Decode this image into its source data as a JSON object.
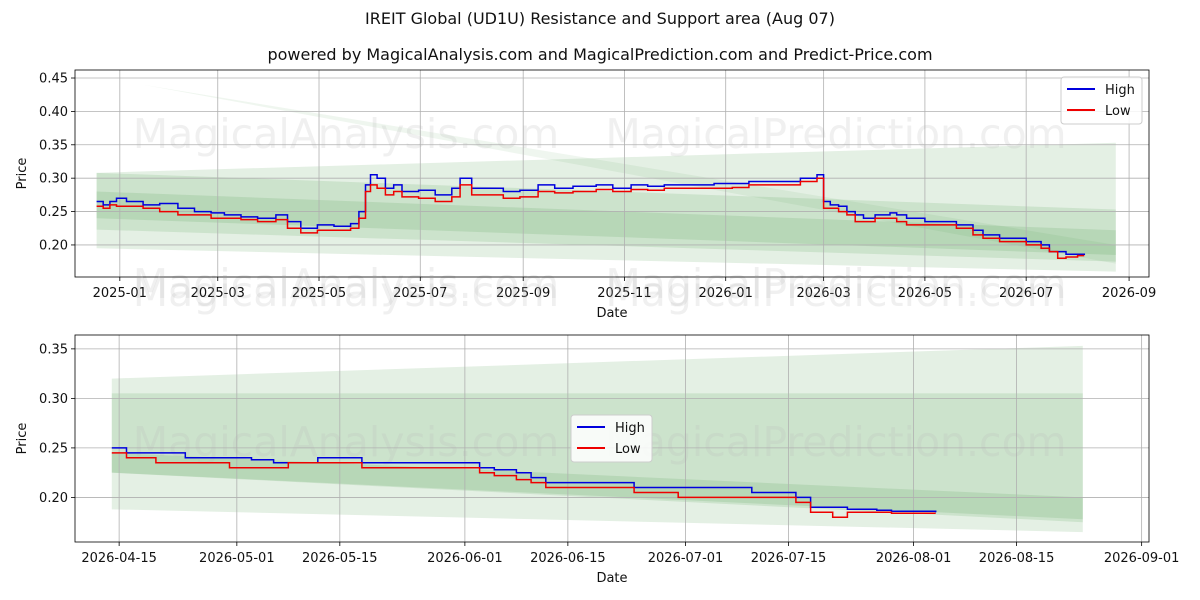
{
  "title": "IREIT Global (UD1U) Resistance and Support area (Aug 07)",
  "subtitle": "powered by MagicalAnalysis.com and MagicalPrediction.com and Predict-Price.com",
  "watermark": [
    "MagicalAnalysis.com",
    "MagicalPrediction.com"
  ],
  "colors": {
    "high": "#0000dd",
    "low": "#ee0000",
    "band": "#2e8b2e",
    "grid": "#b0b0b0"
  },
  "chart_data": [
    {
      "type": "line",
      "xlabel": "Date",
      "ylabel": "Price",
      "x_type": "date",
      "xlim": [
        "2024-12-05",
        "2026-09-13"
      ],
      "ylim": [
        0.152,
        0.462
      ],
      "xticks": [
        "2025-01-01",
        "2025-03-01",
        "2025-05-01",
        "2025-07-01",
        "2025-09-01",
        "2025-11-01",
        "2026-01-01",
        "2026-03-01",
        "2026-05-01",
        "2026-07-01",
        "2026-09-01"
      ],
      "xtick_labels": [
        "2025-01",
        "2025-03",
        "2025-05",
        "2025-07",
        "2025-09",
        "2025-11",
        "2026-01",
        "2026-03",
        "2026-05",
        "2026-07",
        "2026-09"
      ],
      "yticks": [
        0.2,
        0.25,
        0.3,
        0.35,
        0.4,
        0.45
      ],
      "ytick_labels": [
        "0.20",
        "0.25",
        "0.30",
        "0.35",
        "0.40",
        "0.45"
      ],
      "grid": true,
      "legend_position": "top-right",
      "bands": [
        {
          "x": [
            "2024-12-18",
            "2026-08-24"
          ],
          "upper": [
            0.308,
            0.253
          ],
          "lower": [
            0.195,
            0.16
          ]
        },
        {
          "x": [
            "2024-12-18",
            "2026-08-24"
          ],
          "upper": [
            0.28,
            0.222
          ],
          "lower": [
            0.223,
            0.175
          ]
        },
        {
          "x": [
            "2024-12-18",
            "2026-08-24"
          ],
          "upper": [
            0.308,
            0.353
          ],
          "lower": [
            0.24,
            0.185
          ]
        },
        {
          "x": [
            "2025-01-15",
            "2026-08-24"
          ],
          "upper": [
            0.44,
            0.2
          ],
          "lower": [
            0.44,
            0.172
          ]
        }
      ],
      "series": [
        {
          "name": "High",
          "x": [
            "2024-12-18",
            "2024-12-22",
            "2024-12-26",
            "2024-12-30",
            "2025-01-05",
            "2025-01-15",
            "2025-01-25",
            "2025-02-05",
            "2025-02-15",
            "2025-02-25",
            "2025-03-05",
            "2025-03-15",
            "2025-03-25",
            "2025-04-05",
            "2025-04-12",
            "2025-04-20",
            "2025-04-30",
            "2025-05-10",
            "2025-05-20",
            "2025-05-25",
            "2025-05-29",
            "2025-06-01",
            "2025-06-05",
            "2025-06-10",
            "2025-06-15",
            "2025-06-20",
            "2025-06-30",
            "2025-07-10",
            "2025-07-20",
            "2025-07-25",
            "2025-08-01",
            "2025-08-10",
            "2025-08-20",
            "2025-08-30",
            "2025-09-10",
            "2025-09-20",
            "2025-10-01",
            "2025-10-15",
            "2025-10-25",
            "2025-11-05",
            "2025-11-15",
            "2025-11-25",
            "2025-12-05",
            "2025-12-15",
            "2025-12-25",
            "2026-01-05",
            "2026-01-15",
            "2026-01-25",
            "2026-02-05",
            "2026-02-15",
            "2026-02-25",
            "2026-03-01",
            "2026-03-05",
            "2026-03-10",
            "2026-03-15",
            "2026-03-20",
            "2026-03-25",
            "2026-04-01",
            "2026-04-10",
            "2026-04-14",
            "2026-04-20",
            "2026-05-01",
            "2026-05-10",
            "2026-05-20",
            "2026-05-30",
            "2026-06-05",
            "2026-06-10",
            "2026-06-15",
            "2026-06-20",
            "2026-07-01",
            "2026-07-10",
            "2026-07-15",
            "2026-07-20",
            "2026-07-25",
            "2026-08-01",
            "2026-08-05"
          ],
          "values": [
            0.265,
            0.26,
            0.265,
            0.27,
            0.265,
            0.26,
            0.262,
            0.255,
            0.25,
            0.248,
            0.245,
            0.242,
            0.24,
            0.245,
            0.235,
            0.225,
            0.23,
            0.228,
            0.232,
            0.25,
            0.29,
            0.305,
            0.3,
            0.285,
            0.29,
            0.28,
            0.282,
            0.275,
            0.285,
            0.3,
            0.285,
            0.285,
            0.28,
            0.282,
            0.29,
            0.285,
            0.288,
            0.29,
            0.285,
            0.29,
            0.288,
            0.29,
            0.29,
            0.29,
            0.292,
            0.292,
            0.295,
            0.295,
            0.295,
            0.3,
            0.305,
            0.265,
            0.26,
            0.258,
            0.25,
            0.245,
            0.24,
            0.245,
            0.248,
            0.245,
            0.24,
            0.235,
            0.235,
            0.23,
            0.222,
            0.215,
            0.215,
            0.21,
            0.21,
            0.205,
            0.2,
            0.19,
            0.19,
            0.186,
            0.186,
            0.185
          ]
        },
        {
          "name": "Low",
          "x": [
            "2024-12-18",
            "2024-12-22",
            "2024-12-26",
            "2024-12-30",
            "2025-01-05",
            "2025-01-15",
            "2025-01-25",
            "2025-02-05",
            "2025-02-15",
            "2025-02-25",
            "2025-03-05",
            "2025-03-15",
            "2025-03-25",
            "2025-04-05",
            "2025-04-12",
            "2025-04-20",
            "2025-04-30",
            "2025-05-10",
            "2025-05-20",
            "2025-05-25",
            "2025-05-29",
            "2025-06-01",
            "2025-06-05",
            "2025-06-10",
            "2025-06-15",
            "2025-06-20",
            "2025-06-30",
            "2025-07-10",
            "2025-07-20",
            "2025-07-25",
            "2025-08-01",
            "2025-08-10",
            "2025-08-20",
            "2025-08-30",
            "2025-09-10",
            "2025-09-20",
            "2025-10-01",
            "2025-10-15",
            "2025-10-25",
            "2025-11-05",
            "2025-11-15",
            "2025-11-25",
            "2025-12-05",
            "2025-12-15",
            "2025-12-25",
            "2026-01-05",
            "2026-01-15",
            "2026-01-25",
            "2026-02-05",
            "2026-02-15",
            "2026-02-25",
            "2026-03-01",
            "2026-03-05",
            "2026-03-10",
            "2026-03-15",
            "2026-03-20",
            "2026-03-25",
            "2026-04-01",
            "2026-04-10",
            "2026-04-14",
            "2026-04-20",
            "2026-05-01",
            "2026-05-10",
            "2026-05-20",
            "2026-05-30",
            "2026-06-05",
            "2026-06-10",
            "2026-06-15",
            "2026-06-20",
            "2026-07-01",
            "2026-07-10",
            "2026-07-15",
            "2026-07-20",
            "2026-07-25",
            "2026-08-01",
            "2026-08-05"
          ],
          "values": [
            0.258,
            0.255,
            0.26,
            0.258,
            0.258,
            0.255,
            0.25,
            0.245,
            0.245,
            0.24,
            0.24,
            0.238,
            0.235,
            0.238,
            0.225,
            0.218,
            0.222,
            0.222,
            0.225,
            0.24,
            0.28,
            0.29,
            0.285,
            0.275,
            0.28,
            0.272,
            0.27,
            0.265,
            0.272,
            0.29,
            0.275,
            0.275,
            0.27,
            0.272,
            0.28,
            0.278,
            0.28,
            0.283,
            0.28,
            0.283,
            0.282,
            0.285,
            0.285,
            0.285,
            0.285,
            0.286,
            0.29,
            0.29,
            0.29,
            0.295,
            0.3,
            0.255,
            0.255,
            0.25,
            0.245,
            0.235,
            0.235,
            0.24,
            0.24,
            0.235,
            0.23,
            0.23,
            0.23,
            0.225,
            0.215,
            0.21,
            0.21,
            0.205,
            0.205,
            0.2,
            0.195,
            0.19,
            0.18,
            0.182,
            0.184,
            0.184
          ]
        }
      ]
    },
    {
      "type": "line",
      "xlabel": "Date",
      "ylabel": "Price",
      "x_type": "date",
      "xlim": [
        "2026-04-09",
        "2026-09-02"
      ],
      "ylim": [
        0.155,
        0.364
      ],
      "xticks": [
        "2026-04-15",
        "2026-05-01",
        "2026-05-15",
        "2026-06-01",
        "2026-06-15",
        "2026-07-01",
        "2026-07-15",
        "2026-08-01",
        "2026-08-15",
        "2026-09-01"
      ],
      "xtick_labels": [
        "2026-04-15",
        "2026-05-01",
        "2026-05-15",
        "2026-06-01",
        "2026-06-15",
        "2026-07-01",
        "2026-07-15",
        "2026-08-01",
        "2026-08-15",
        "2026-09-01"
      ],
      "yticks": [
        0.2,
        0.25,
        0.3,
        0.35
      ],
      "ytick_labels": [
        "0.20",
        "0.25",
        "0.30",
        "0.35"
      ],
      "grid": true,
      "legend_position": "center",
      "bands": [
        {
          "x": [
            "2026-04-14",
            "2026-08-24"
          ],
          "upper": [
            0.32,
            0.353
          ],
          "lower": [
            0.188,
            0.165
          ]
        },
        {
          "x": [
            "2026-04-14",
            "2026-08-24"
          ],
          "upper": [
            0.305,
            0.305
          ],
          "lower": [
            0.225,
            0.175
          ]
        },
        {
          "x": [
            "2026-04-14",
            "2026-08-24"
          ],
          "upper": [
            0.245,
            0.2
          ],
          "lower": [
            0.225,
            0.178
          ]
        }
      ],
      "series": [
        {
          "name": "High",
          "x": [
            "2026-04-14",
            "2026-04-16",
            "2026-04-20",
            "2026-04-24",
            "2026-04-27",
            "2026-04-30",
            "2026-05-03",
            "2026-05-06",
            "2026-05-08",
            "2026-05-12",
            "2026-05-14",
            "2026-05-18",
            "2026-05-22",
            "2026-05-27",
            "2026-06-01",
            "2026-06-03",
            "2026-06-05",
            "2026-06-08",
            "2026-06-10",
            "2026-06-12",
            "2026-06-22",
            "2026-06-24",
            "2026-06-30",
            "2026-07-10",
            "2026-07-14",
            "2026-07-16",
            "2026-07-18",
            "2026-07-21",
            "2026-07-23",
            "2026-07-27",
            "2026-07-29",
            "2026-08-04"
          ],
          "values": [
            0.25,
            0.245,
            0.245,
            0.24,
            0.24,
            0.24,
            0.238,
            0.235,
            0.235,
            0.24,
            0.24,
            0.235,
            0.235,
            0.235,
            0.235,
            0.23,
            0.228,
            0.225,
            0.22,
            0.215,
            0.215,
            0.21,
            0.21,
            0.205,
            0.205,
            0.2,
            0.19,
            0.19,
            0.188,
            0.187,
            0.186,
            0.185
          ]
        },
        {
          "name": "Low",
          "x": [
            "2026-04-14",
            "2026-04-16",
            "2026-04-20",
            "2026-04-24",
            "2026-04-27",
            "2026-04-30",
            "2026-05-03",
            "2026-05-06",
            "2026-05-08",
            "2026-05-12",
            "2026-05-14",
            "2026-05-18",
            "2026-05-22",
            "2026-05-27",
            "2026-06-01",
            "2026-06-03",
            "2026-06-05",
            "2026-06-08",
            "2026-06-10",
            "2026-06-12",
            "2026-06-22",
            "2026-06-24",
            "2026-06-30",
            "2026-07-10",
            "2026-07-14",
            "2026-07-16",
            "2026-07-18",
            "2026-07-21",
            "2026-07-23",
            "2026-07-27",
            "2026-07-29",
            "2026-08-04"
          ],
          "values": [
            0.245,
            0.24,
            0.235,
            0.235,
            0.235,
            0.23,
            0.23,
            0.23,
            0.235,
            0.235,
            0.235,
            0.23,
            0.23,
            0.23,
            0.23,
            0.225,
            0.222,
            0.218,
            0.215,
            0.21,
            0.21,
            0.205,
            0.2,
            0.2,
            0.2,
            0.195,
            0.185,
            0.18,
            0.185,
            0.185,
            0.184,
            0.184
          ]
        }
      ]
    }
  ]
}
